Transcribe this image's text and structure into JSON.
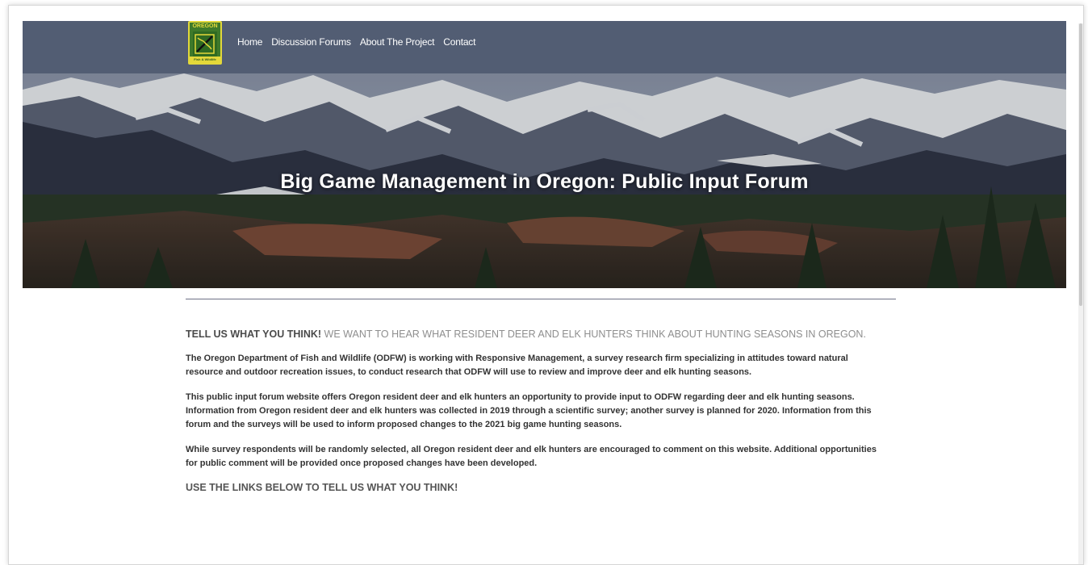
{
  "logo": {
    "top_text": "OREGON",
    "bottom_text": "Fish & Wildlife",
    "colors": {
      "green": "#3f7a2a",
      "yellow": "#e3d83a"
    }
  },
  "nav": {
    "items": [
      {
        "label": "Home"
      },
      {
        "label": "Discussion Forums"
      },
      {
        "label": "About The Project"
      },
      {
        "label": "Contact"
      }
    ],
    "background": "#525d73"
  },
  "hero": {
    "title": "Big Game Management in Oregon: Public Input Forum"
  },
  "content": {
    "tell_bold": "TELL US WHAT YOU THINK!",
    "tell_rest": " WE WANT TO HEAR WHAT RESIDENT DEER AND ELK HUNTERS THINK ABOUT HUNTING SEASONS IN OREGON.",
    "paragraphs": [
      "The Oregon Department of Fish and Wildlife (ODFW) is working with Responsive Management, a survey research firm specializing in attitudes toward natural resource and outdoor recreation issues, to conduct research that ODFW will use to review and improve deer and elk hunting seasons.",
      "This public input forum website offers Oregon resident deer and elk hunters an opportunity to provide input to ODFW regarding deer and elk hunting seasons. Information from Oregon resident deer and elk hunters was collected in 2019 through a scientific survey; another survey is planned for 2020. Information from this forum and the surveys will be used to inform proposed changes to the 2021 big game hunting seasons.",
      "While survey respondents will be randomly selected, all Oregon resident deer and elk hunters are encouraged to comment on this website. Additional opportunities for public comment will be provided once proposed changes have been developed."
    ],
    "links_heading": "USE THE LINKS BELOW TO TELL US WHAT YOU THINK!"
  }
}
